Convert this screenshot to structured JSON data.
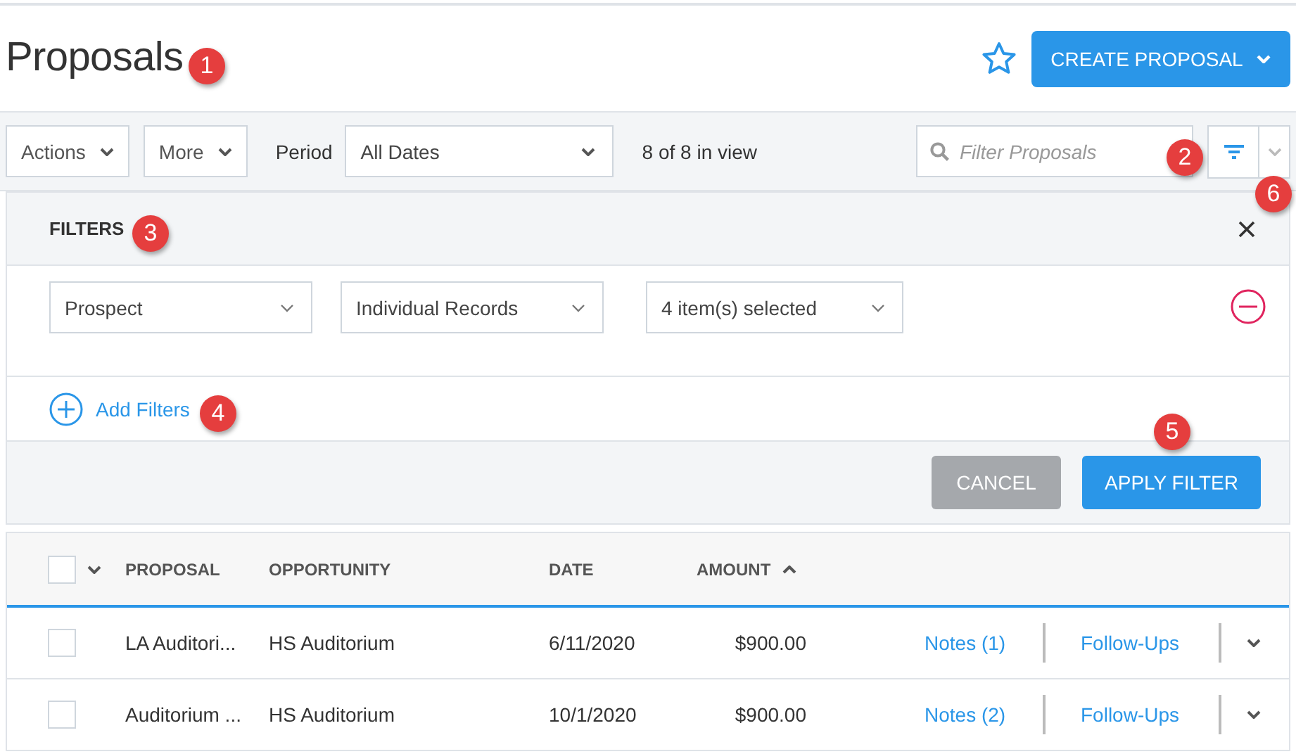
{
  "page": {
    "title": "Proposals",
    "favorite": false,
    "create_button": "CREATE PROPOSAL"
  },
  "toolbar": {
    "actions": "Actions",
    "more": "More",
    "period_label": "Period",
    "period_value": "All Dates",
    "count": "8 of 8 in view",
    "search": {
      "placeholder": "Filter Proposals"
    }
  },
  "filters": {
    "title": "FILTERS",
    "rows": [
      {
        "field": "Prospect",
        "operator": "Individual Records",
        "value": "4 item(s) selected"
      }
    ],
    "add": "Add Filters",
    "cancel": "CANCEL",
    "apply": "APPLY FILTER"
  },
  "table": {
    "select_all": false,
    "columns": [
      "PROPOSAL",
      "OPPORTUNITY",
      "DATE",
      "AMOUNT"
    ],
    "rows": [
      {
        "checked": false,
        "cells": [
          "LA Auditori...",
          "HS Auditorium",
          "6/11/2020",
          "$900.00"
        ],
        "notes": "Notes (1)",
        "followups": "Follow-Ups"
      },
      {
        "checked": false,
        "cells": [
          "Auditorium ...",
          "HS Auditorium",
          "10/1/2020",
          "$900.00"
        ],
        "notes": "Notes (2)",
        "followups": "Follow-Ups"
      }
    ]
  },
  "callouts": [
    "1",
    "2",
    "3",
    "4",
    "5",
    "6"
  ]
}
